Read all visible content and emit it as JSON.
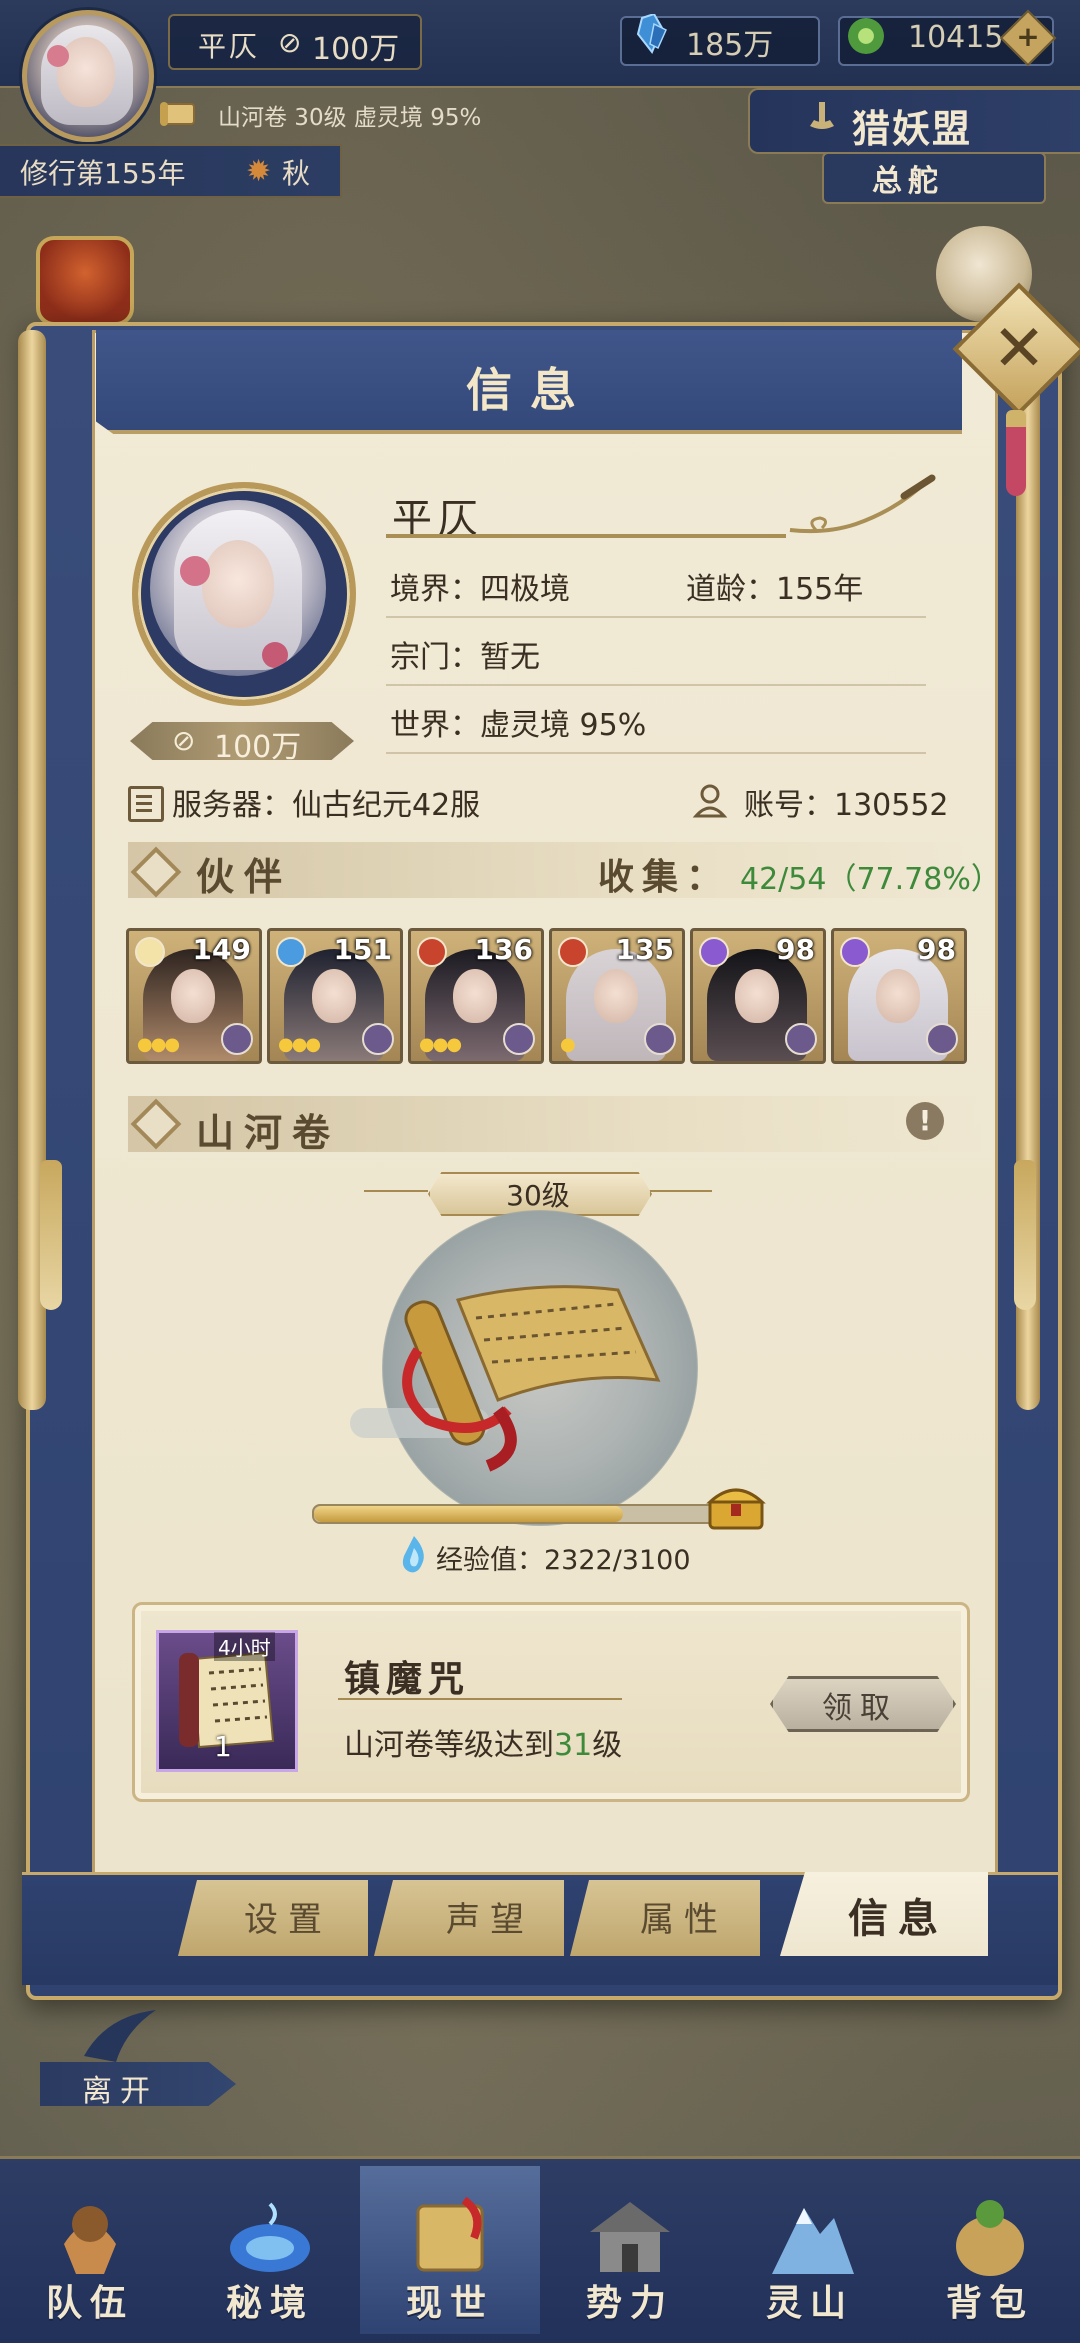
{
  "hud": {
    "player_name": "平仄",
    "power": "100万",
    "gems": "185万",
    "jade": "10415",
    "sub_info": "山河卷 30级 虚灵境 95%",
    "year": "修行第155年",
    "season": "秋",
    "guild_name": "猎妖盟",
    "guild_sub": "总舵"
  },
  "panel": {
    "title": "信息",
    "profile": {
      "name": "平仄",
      "realm": "境界：四极境",
      "age": "道龄：155年",
      "sect": "宗门：暂无",
      "world": "世界：虚灵境  95%",
      "power": "100万",
      "server": "服务器：仙古纪元42服",
      "account": "账号：130552"
    },
    "partners": {
      "section_title": "伙伴",
      "collect_label": "收集：",
      "collect_value": "42/54（77.78%）",
      "cards": [
        {
          "level": "149",
          "stars": 3,
          "element_color": "#f3e3a8"
        },
        {
          "level": "151",
          "stars": 3,
          "element_color": "#4b9be0"
        },
        {
          "level": "136",
          "stars": 3,
          "element_color": "#c9442c"
        },
        {
          "level": "135",
          "stars": 1,
          "element_color": "#c9442c"
        },
        {
          "level": "98",
          "stars": 0,
          "element_color": "#8a5ad0"
        },
        {
          "level": "98",
          "stars": 0,
          "element_color": "#8a5ad0"
        }
      ]
    },
    "scroll": {
      "section_title": "山河卷",
      "level": "30级",
      "exp_label": "经验值：",
      "exp_value": "2322/3100",
      "exp_fraction": 0.749
    },
    "reward": {
      "time_badge": "4小时",
      "count": "1",
      "name": "镇魔咒",
      "desc_prefix": "山河卷等级达到",
      "desc_level": "31",
      "desc_suffix": "级",
      "claim_label": "领取"
    },
    "tabs": [
      "设置",
      "声望",
      "属性",
      "信息"
    ],
    "active_tab": "信息"
  },
  "leave_label": "离开",
  "nav": [
    {
      "label": "队伍",
      "icon": "team-icon"
    },
    {
      "label": "秘境",
      "icon": "secret-realm-icon"
    },
    {
      "label": "现世",
      "icon": "world-icon"
    },
    {
      "label": "势力",
      "icon": "faction-icon"
    },
    {
      "label": "灵山",
      "icon": "spirit-mountain-icon"
    },
    {
      "label": "背包",
      "icon": "bag-icon"
    }
  ],
  "colors": {
    "accent_gold": "#c7a969",
    "panel_blue": "#34497a",
    "paper": "#f1ead6",
    "collect_green": "#3d8a3a"
  }
}
